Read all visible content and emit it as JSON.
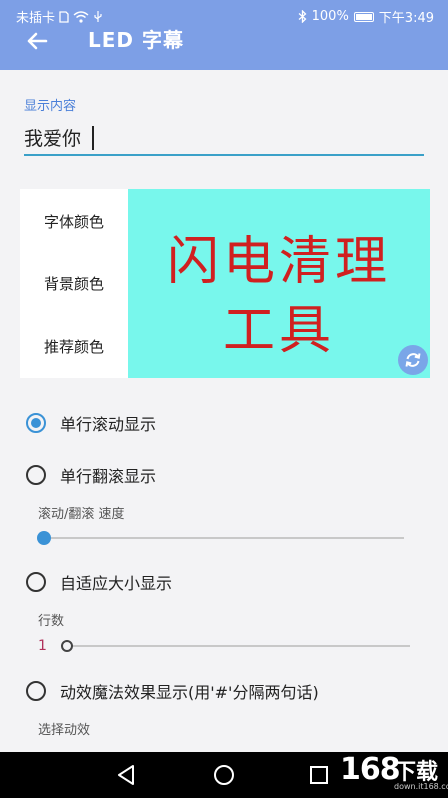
{
  "status_bar": {
    "carrier": "未插卡",
    "battery": "100%",
    "time": "下午3:49"
  },
  "app_bar": {
    "title": "LED 字幕"
  },
  "content_field": {
    "label": "显示内容",
    "value": "我爱你"
  },
  "color_options": [
    "字体颜色",
    "背景颜色",
    "推荐颜色"
  ],
  "preview": {
    "lines": [
      "闪电清理",
      "工具"
    ],
    "text_color": "#d02020",
    "background_color": "#78f7ec"
  },
  "modes": [
    {
      "label": "单行滚动显示",
      "selected": true
    },
    {
      "label": "单行翻滚显示",
      "selected": false
    },
    {
      "label": "自适应大小显示",
      "selected": false
    },
    {
      "label": "动效魔法效果显示(用'#'分隔两句话)",
      "selected": false
    }
  ],
  "speed": {
    "label": "滚动/翻滚 速度",
    "level": 0
  },
  "rows": {
    "label": "行数",
    "value": "1"
  },
  "effect": {
    "label": "选择动效"
  },
  "watermark": {
    "number": "168",
    "text": "下载",
    "url": "down.it168.com"
  },
  "colors": {
    "accent": "#7d9fe6",
    "selected": "#3a92d6",
    "underline": "#3aa0c8"
  }
}
